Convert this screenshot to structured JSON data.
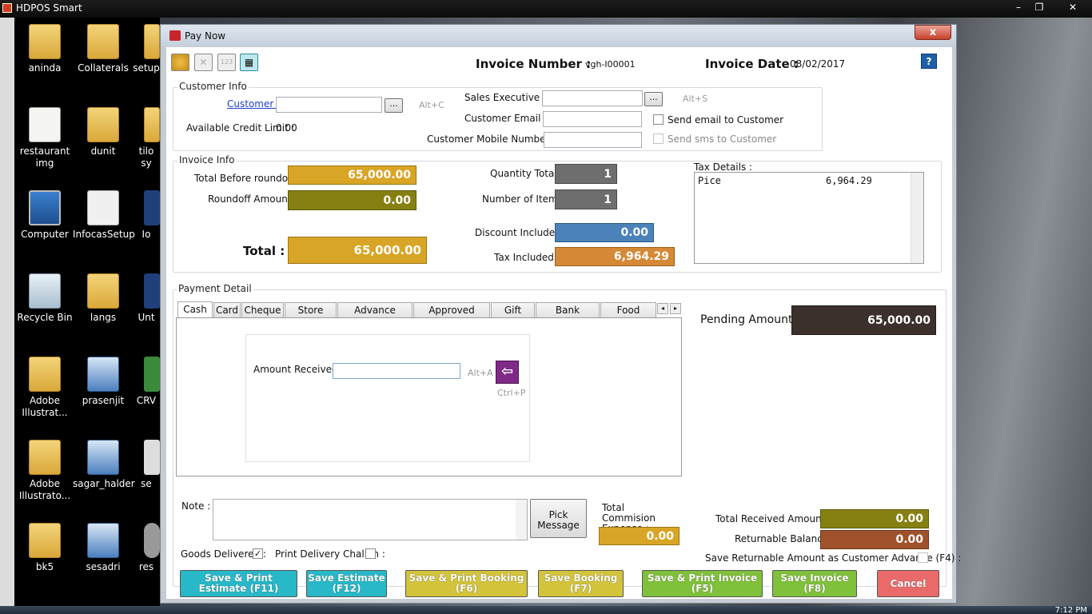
{
  "app": {
    "title": "HDPOS Smart"
  },
  "desktop": {
    "icons": [
      {
        "label": "aninda"
      },
      {
        "label": "Collaterals"
      },
      {
        "label": "setup"
      },
      {
        "label": "restaurant img"
      },
      {
        "label": "dunit"
      },
      {
        "label": "tilo sy"
      },
      {
        "label": "Computer"
      },
      {
        "label": "InfocasSetup"
      },
      {
        "label": "Io"
      },
      {
        "label": "Recycle Bin"
      },
      {
        "label": "langs"
      },
      {
        "label": "Unt"
      },
      {
        "label": "Adobe Illustrat..."
      },
      {
        "label": "prasenjit"
      },
      {
        "label": "CRV"
      },
      {
        "label": "Adobe Illustrato..."
      },
      {
        "label": "sagar_halder"
      },
      {
        "label": "se"
      },
      {
        "label": "bk5"
      },
      {
        "label": "sesadri"
      },
      {
        "label": "res"
      }
    ]
  },
  "dialog": {
    "title": "Pay Now",
    "close": "x",
    "invoice_number_label": "Invoice Number :",
    "invoice_number": "vgh-I00001",
    "invoice_date_label": "Invoice Date :",
    "invoice_date": "08/02/2017",
    "help": "?",
    "customer_info": {
      "caption": "Customer Info",
      "customer_label": "Customer :",
      "customer_shortcut": "Alt+C",
      "credit_label": "Available Credit Limit :",
      "credit_value": "0.00",
      "sales_exec_label": "Sales Executive :",
      "sales_exec_shortcut": "Alt+S",
      "email_label": "Customer Email :",
      "mobile_label": "Customer Mobile Number :",
      "send_email": "Send email to Customer",
      "send_sms": "Send sms to Customer",
      "ellipsis": "..."
    },
    "invoice_info": {
      "caption": "Invoice Info",
      "before_roundoff_label": "Total  Before roundoff :",
      "before_roundoff": "65,000.00",
      "roundoff_label": "Roundoff Amount  :",
      "roundoff": "0.00",
      "total_label": "Total :",
      "total": "65,000.00",
      "qty_label": "Quantity Total :",
      "qty": "1",
      "items_label": "Number of Items :",
      "items": "1",
      "discount_label": "Discount Included :",
      "discount": "0.00",
      "tax_label": "Tax Included :",
      "tax": "6,964.29",
      "tax_details_label": "Tax Details :",
      "tax_details": [
        {
          "name": "Pice",
          "amount": "6,964.29"
        }
      ]
    },
    "payment": {
      "caption": "Payment Detail",
      "tabs": [
        "Cash",
        "Card",
        "Cheque",
        "Store Credit",
        "Advance Amount",
        "Approved Pending",
        "Gift Card",
        "Bank Transfer",
        "Food Coupon"
      ],
      "amount_received_label": "Amount Received :",
      "amount_shortcut": "Alt+A",
      "apply_shortcut": "Ctrl+P",
      "pending_label": "Pending Amount :",
      "pending": "65,000.00"
    },
    "note_label": "Note :",
    "pick_message": "Pick Message",
    "commission_label": "Total Commision Expense :",
    "commission": "0.00",
    "goods_delivered": "Goods Delivered :",
    "print_challan": "Print Delivery Challan :",
    "total_received_label": "Total Received  Amount  :",
    "total_received": "0.00",
    "returnable_label": "Returnable Balance  :",
    "returnable": "0.00",
    "save_advance": "Save Returnable Amount as Customer Advance (F4) :",
    "buttons": {
      "b1": "Save & Print Estimate (F11)",
      "b2": "Save Estimate (F12)",
      "b3": "Save & Print Booking (F6)",
      "b4": "Save Booking (F7)",
      "b5": "Save & Print Invoice (F5)",
      "b6": "Save Invoice (F8)",
      "cancel": "Cancel"
    },
    "colors": {
      "gold": "#d9a526",
      "olive": "#858011",
      "slate": "#6e6e6e",
      "blue": "#4a82b9",
      "orange": "#d58936",
      "dark": "#3b302b",
      "brown": "#a0522d"
    }
  },
  "clock": "7:12 PM"
}
